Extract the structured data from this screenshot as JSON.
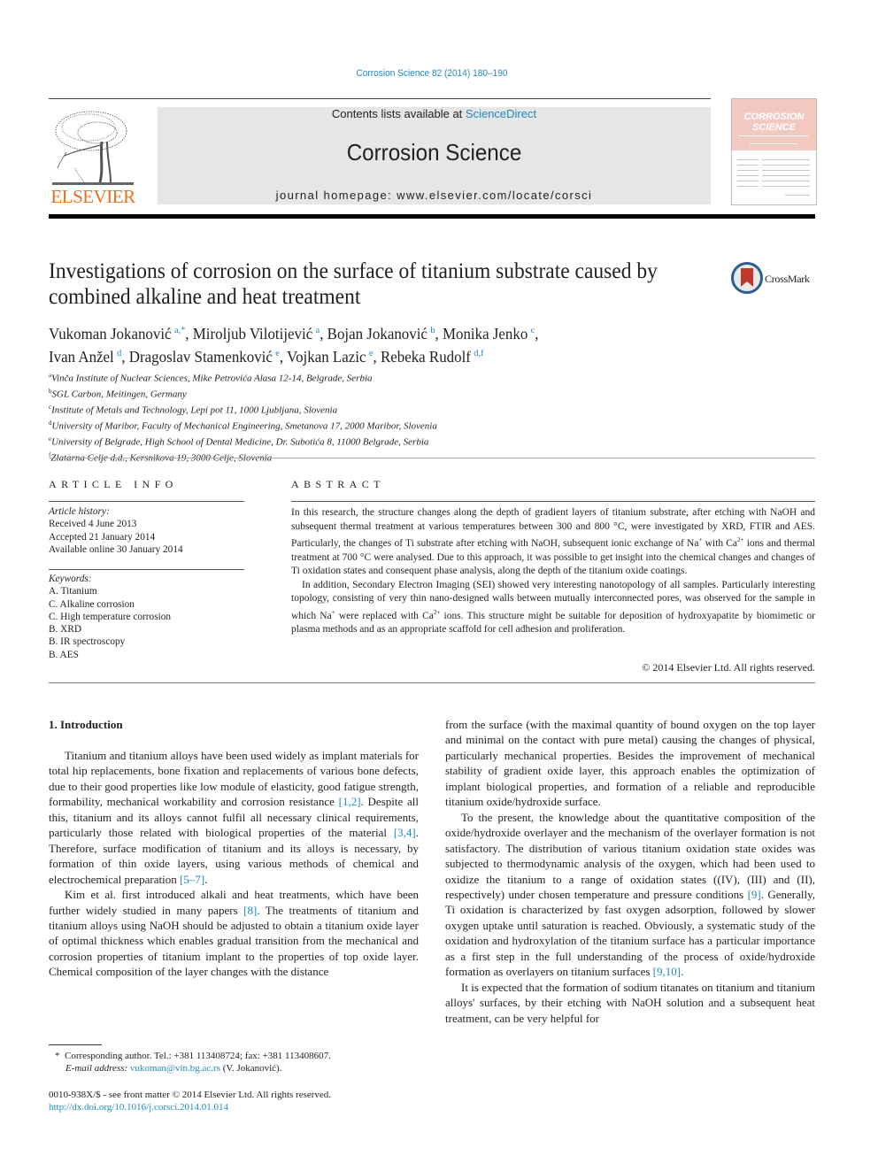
{
  "header": {
    "citation": "Corrosion Science 82 (2014) 180–190",
    "contents_prefix": "Contents lists available at ",
    "contents_link": "ScienceDirect",
    "journal_title": "Corrosion Science",
    "homepage": "journal homepage: www.elsevier.com/locate/corsci",
    "publisher_logo_text": "ELSEVIER",
    "cover_title_line1": "CORROSION",
    "cover_title_line2": "SCIENCE"
  },
  "colors": {
    "link": "#1f8ac0",
    "elsevier_orange": "#e9711c",
    "masthead_gray": "#e6e6e6",
    "cover_pink": "#f2c9c0",
    "crossmark_red": "#c0392b",
    "crossmark_blue": "#2c5e8f"
  },
  "article": {
    "title": "Investigations of corrosion on the surface of titanium substrate caused by combined alkaline and heat treatment",
    "crossmark_label": "CrossMark",
    "authors": [
      {
        "name": "Vukoman Jokanović",
        "aff": "a,*",
        "sep": ", "
      },
      {
        "name": "Miroljub Vilotijević",
        "aff": "a",
        "sep": ", "
      },
      {
        "name": "Bojan Jokanović",
        "aff": "b",
        "sep": ", "
      },
      {
        "name": "Monika Jenko",
        "aff": "c",
        "sep": ","
      },
      {
        "name": "Ivan Anžel",
        "aff": "d",
        "sep": ", "
      },
      {
        "name": "Dragoslav Stamenković",
        "aff": "e",
        "sep": ", "
      },
      {
        "name": "Vojkan Lazic",
        "aff": "e",
        "sep": ", "
      },
      {
        "name": "Rebeka Rudolf",
        "aff": "d,f",
        "sep": ""
      }
    ],
    "affiliations": [
      {
        "key": "a",
        "text": "Vinča Institute of Nuclear Sciences, Mike Petrovića Alasa 12-14, Belgrade, Serbia"
      },
      {
        "key": "b",
        "text": "SGL Carbon, Meitingen, Germany"
      },
      {
        "key": "c",
        "text": "Institute of Metals and Technology, Lepi pot 11, 1000 Ljubljana, Slovenia"
      },
      {
        "key": "d",
        "text": "University of Maribor, Faculty of Mechanical Engineering, Smetanova 17, 2000 Maribor, Slovenia"
      },
      {
        "key": "e",
        "text": "University of Belgrade, High School of Dental Medicine, Dr. Subotića 8, 11000 Belgrade, Serbia"
      },
      {
        "key": "f",
        "text": "Zlatarna Celje d.d., Kersnikova 19, 3000 Celje, Slovenia"
      }
    ]
  },
  "article_info": {
    "heading": "ARTICLE INFO",
    "history_label": "Article history:",
    "history": [
      "Received 4 June 2013",
      "Accepted 21 January 2014",
      "Available online 30 January 2014"
    ],
    "keywords_label": "Keywords:",
    "keywords": [
      "A. Titanium",
      "C. Alkaline corrosion",
      "C. High temperature corrosion",
      "B. XRD",
      "B. IR spectroscopy",
      "B. AES"
    ]
  },
  "abstract": {
    "heading": "ABSTRACT",
    "p1_a": "In this research, the structure changes along the depth of gradient layers of titanium substrate, after etching with NaOH and subsequent thermal treatment at various temperatures between 300 and 800 °C, were investigated by XRD, FTIR and AES. Particularly, the changes of Ti substrate after etching with NaOH, subsequent ionic exchange of Na",
    "p1_sup1": "+",
    "p1_b": " with Ca",
    "p1_sup2": "2+",
    "p1_c": " ions and thermal treatment at 700 °C were analysed. Due to this approach, it was possible to get insight into the chemical changes and changes of Ti oxidation states and consequent phase analysis, along the depth of the titanium oxide coatings.",
    "p2_a": "In addition, Secondary Electron Imaging (SEI) showed very interesting nanotopology of all samples. Particularly interesting topology, consisting of very thin nano-designed walls between mutually interconnected pores, was observed for the sample in which Na",
    "p2_sup1": "+",
    "p2_b": " were replaced with Ca",
    "p2_sup2": "2+",
    "p2_c": " ions. This structure might be suitable for deposition of hydroxyapatite by biomimetic or plasma methods and as an appropriate scaffold for cell adhesion and proliferation.",
    "copyright": "© 2014 Elsevier Ltd. All rights reserved."
  },
  "body": {
    "section_heading": "1. Introduction",
    "left_p1_a": "Titanium and titanium alloys have been used widely as implant materials for total hip replacements, bone fixation and replacements of various bone defects, due to their good properties like low module of elasticity, good fatigue strength, formability, mechanical workability and corrosion resistance ",
    "left_p1_ref1": "[1,2]",
    "left_p1_b": ". Despite all this, titanium and its alloys cannot fulfil all necessary clinical requirements, particularly those related with biological properties of the material ",
    "left_p1_ref2": "[3,4]",
    "left_p1_c": ". Therefore, surface modification of titanium and its alloys is necessary, by formation of thin oxide layers, using various methods of chemical and electrochemical preparation ",
    "left_p1_ref3": "[5–7]",
    "left_p1_d": ".",
    "left_p2_a": "Kim et al. first introduced alkali and heat treatments, which have been further widely studied in many papers ",
    "left_p2_ref1": "[8]",
    "left_p2_b": ". The treatments of titanium and titanium alloys using NaOH should be adjusted to obtain a titanium oxide layer of optimal thickness which enables gradual transition from the mechanical and corrosion properties of titanium implant to the properties of top oxide layer. Chemical composition of the layer changes with the distance",
    "right_p1": "from the surface (with the maximal quantity of bound oxygen on the top layer and minimal on the contact with pure metal) causing the changes of physical, particularly mechanical properties. Besides the improvement of mechanical stability of gradient oxide layer, this approach enables the optimization of implant biological properties, and formation of a reliable and reproducible titanium oxide/hydroxide surface.",
    "right_p2_a": "To the present, the knowledge about the quantitative composition of the oxide/hydroxide overlayer and the mechanism of the overlayer formation is not satisfactory. The distribution of various titanium oxidation state oxides was subjected to thermodynamic analysis of the oxygen, which had been used to oxidize the titanium to a range of oxidation states ((IV), (III) and (II), respectively) under chosen temperature and pressure conditions ",
    "right_p2_ref1": "[9]",
    "right_p2_b": ". Generally, Ti oxidation is characterized by fast oxygen adsorption, followed by slower oxygen uptake until saturation is reached. Obviously, a systematic study of the oxidation and hydroxylation of the titanium surface has a particular importance as a first step in the full understanding of the process of oxide/hydroxide formation as overlayers on titanium surfaces ",
    "right_p2_ref2": "[9,10]",
    "right_p2_c": ".",
    "right_p3": "It is expected that the formation of sodium titanates on titanium and titanium alloys' surfaces, by their etching with NaOH solution and a subsequent heat treatment, can be very helpful for"
  },
  "footnotes": {
    "star": "*",
    "corresponding": "Corresponding author. Tel.: +381 113408724; fax: +381 113408607.",
    "email_label": "E-mail address:",
    "email": "vukoman@vin.bg.ac.rs",
    "email_suffix": " (V. Jokanović).",
    "issn_line": "0010-938X/$ - see front matter © 2014 Elsevier Ltd. All rights reserved.",
    "doi": "http://dx.doi.org/10.1016/j.corsci.2014.01.014"
  },
  "icons": {
    "publisher_logo": "elsevier-tree-icon",
    "crossmark": "crossmark-icon",
    "cover": "journal-cover-thumbnail"
  }
}
